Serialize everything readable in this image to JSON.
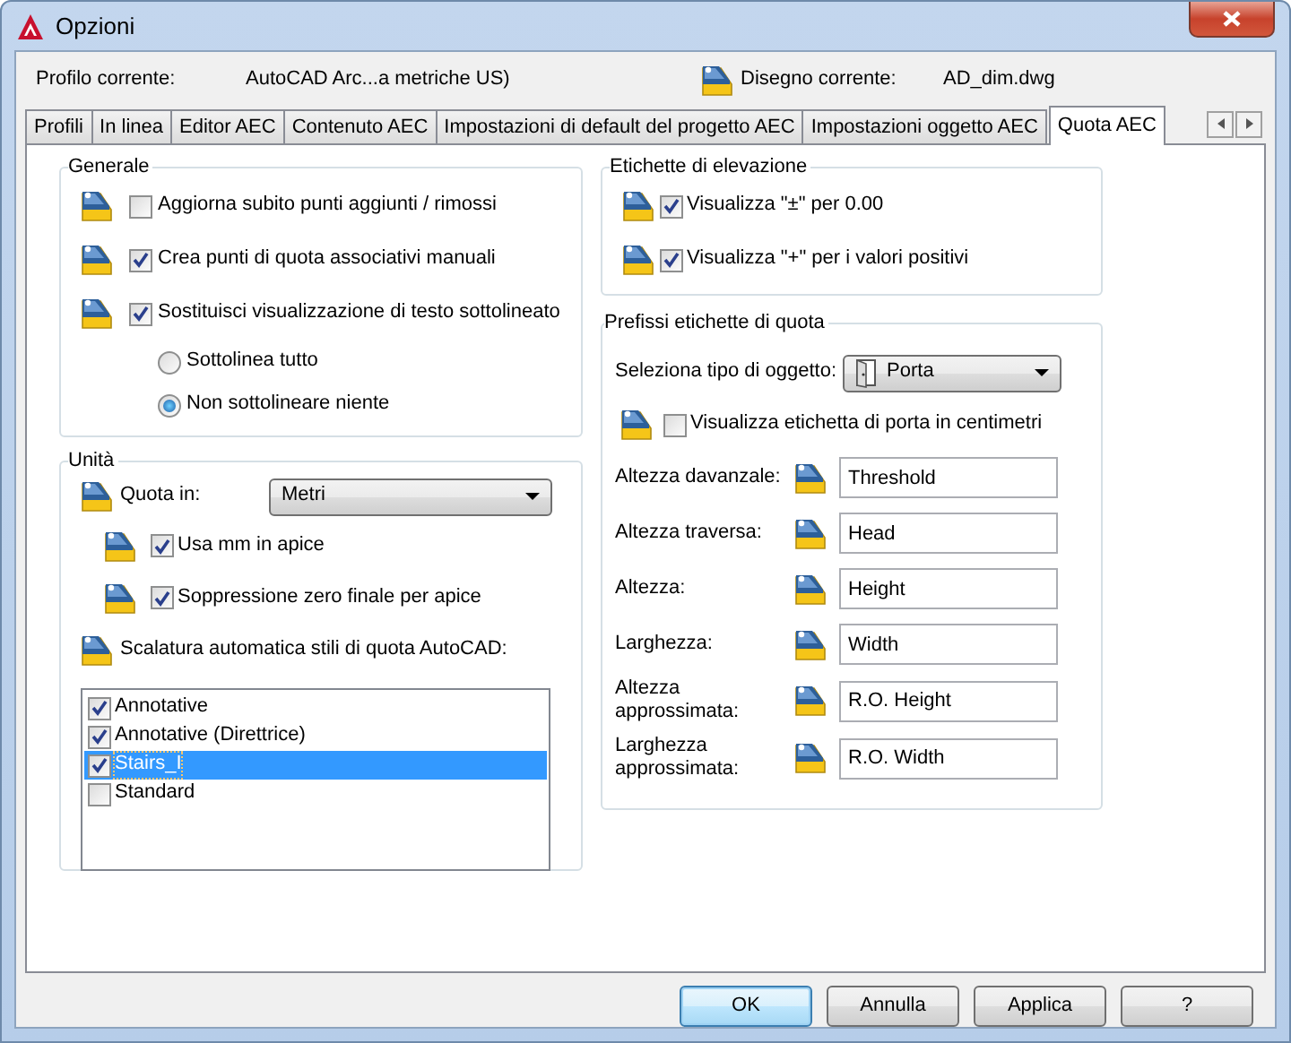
{
  "window": {
    "title": "Opzioni"
  },
  "profile": {
    "label": "Profilo corrente:",
    "value": "AutoCAD Arc...a metriche US)"
  },
  "drawing": {
    "label": "Disegno corrente:",
    "value": "AD_dim.dwg"
  },
  "tabs": [
    {
      "label": "Profili",
      "selected": false
    },
    {
      "label": "In linea",
      "selected": false
    },
    {
      "label": "Editor AEC",
      "selected": false
    },
    {
      "label": "Contenuto AEC",
      "selected": false
    },
    {
      "label": "Impostazioni di default del progetto AEC",
      "selected": false
    },
    {
      "label": "Impostazioni oggetto AEC",
      "selected": false
    },
    {
      "label": "Quota AEC",
      "selected": true
    }
  ],
  "general": {
    "title": "Generale",
    "options": [
      {
        "label": "Aggiorna subito punti aggiunti / rimossi",
        "checked": false
      },
      {
        "label": "Crea punti di quota associativi manuali",
        "checked": true
      },
      {
        "label": "Sostituisci visualizzazione di testo sottolineato",
        "checked": true
      }
    ],
    "radios": [
      {
        "label": "Sottolinea tutto",
        "selected": false
      },
      {
        "label": "Non sottolineare niente",
        "selected": true
      }
    ]
  },
  "units": {
    "title": "Unità",
    "dimension": {
      "label": "Quota in:",
      "value": "Metri"
    },
    "options": [
      {
        "label": "Usa mm in apice",
        "checked": true
      },
      {
        "label": "Soppressione zero finale per apice",
        "checked": true
      }
    ],
    "scale_label": "Scalatura automatica stili di quota AutoCAD:",
    "styles": [
      {
        "label": "Annotative",
        "checked": true,
        "selected": false
      },
      {
        "label": "Annotative (Direttrice)",
        "checked": true,
        "selected": false
      },
      {
        "label": "Stairs_I",
        "checked": true,
        "selected": true
      },
      {
        "label": "Standard",
        "checked": false,
        "selected": false
      }
    ]
  },
  "elevation": {
    "title": "Etichette di elevazione",
    "options": [
      {
        "label": "Visualizza \"±\" per 0.00",
        "checked": true
      },
      {
        "label": "Visualizza \"+\" per i valori positivi",
        "checked": true
      }
    ]
  },
  "prefixes": {
    "title": "Prefissi etichette di quota",
    "object_type": {
      "label": "Seleziona tipo di oggetto:",
      "value": "Porta"
    },
    "options": [
      {
        "label": "Visualizza etichetta di porta in centimetri",
        "checked": false
      }
    ],
    "fields": [
      {
        "label": "Altezza davanzale:",
        "value": "Threshold"
      },
      {
        "label": "Altezza traversa:",
        "value": "Head"
      },
      {
        "label": "Altezza:",
        "value": "Height"
      },
      {
        "label": "Larghezza:",
        "value": "Width"
      },
      {
        "label": "Altezza approssimata:",
        "value": "R.O. Height"
      },
      {
        "label": "Larghezza approssimata:",
        "value": "R.O. Width"
      }
    ]
  },
  "buttons": [
    {
      "label": "OK",
      "focused": true
    },
    {
      "label": "Annulla",
      "focused": false
    },
    {
      "label": "Applica",
      "focused": false
    },
    {
      "label": "?",
      "focused": false
    }
  ]
}
